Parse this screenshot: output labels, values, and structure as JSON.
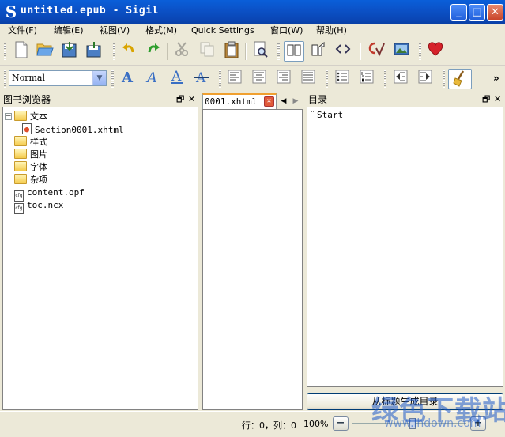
{
  "window": {
    "title": "untitled.epub - Sigil",
    "app_icon": "S",
    "controls": {
      "minimize": "_",
      "maximize": "□",
      "close": "✕"
    }
  },
  "menubar": {
    "items": [
      "文件(F)",
      "编辑(E)",
      "视图(V)",
      "格式(M)",
      "Quick Settings",
      "窗口(W)",
      "帮助(H)"
    ]
  },
  "toolbar": {
    "style_select": {
      "value": "Normal"
    },
    "overflow": "»"
  },
  "book_browser": {
    "title": "图书浏览器",
    "float_icon": "🗗",
    "close_icon": "✕",
    "tree": [
      {
        "label": "文本",
        "type": "folder",
        "expanded": true
      },
      {
        "label": "Section0001.xhtml",
        "type": "xhtml"
      },
      {
        "label": "样式",
        "type": "folder"
      },
      {
        "label": "图片",
        "type": "folder"
      },
      {
        "label": "字体",
        "type": "folder"
      },
      {
        "label": "杂项",
        "type": "folder"
      },
      {
        "label": "content.opf",
        "type": "file"
      },
      {
        "label": "toc.ncx",
        "type": "file"
      }
    ]
  },
  "editor": {
    "tab_label": "0001.xhtml"
  },
  "toc": {
    "title": "目录",
    "float_icon": "🗗",
    "close_icon": "✕",
    "items": [
      "Start"
    ],
    "generate_button": "从标题生成目录"
  },
  "status": {
    "position": "行：0，列：0",
    "zoom": "100%"
  },
  "watermark": {
    "text": "绿色下载站",
    "url": "www.lhdown.com"
  },
  "colors": {
    "titlebar": "#0b52c8",
    "tab_accent": "#f0a030",
    "favorite": "#d6222a"
  }
}
